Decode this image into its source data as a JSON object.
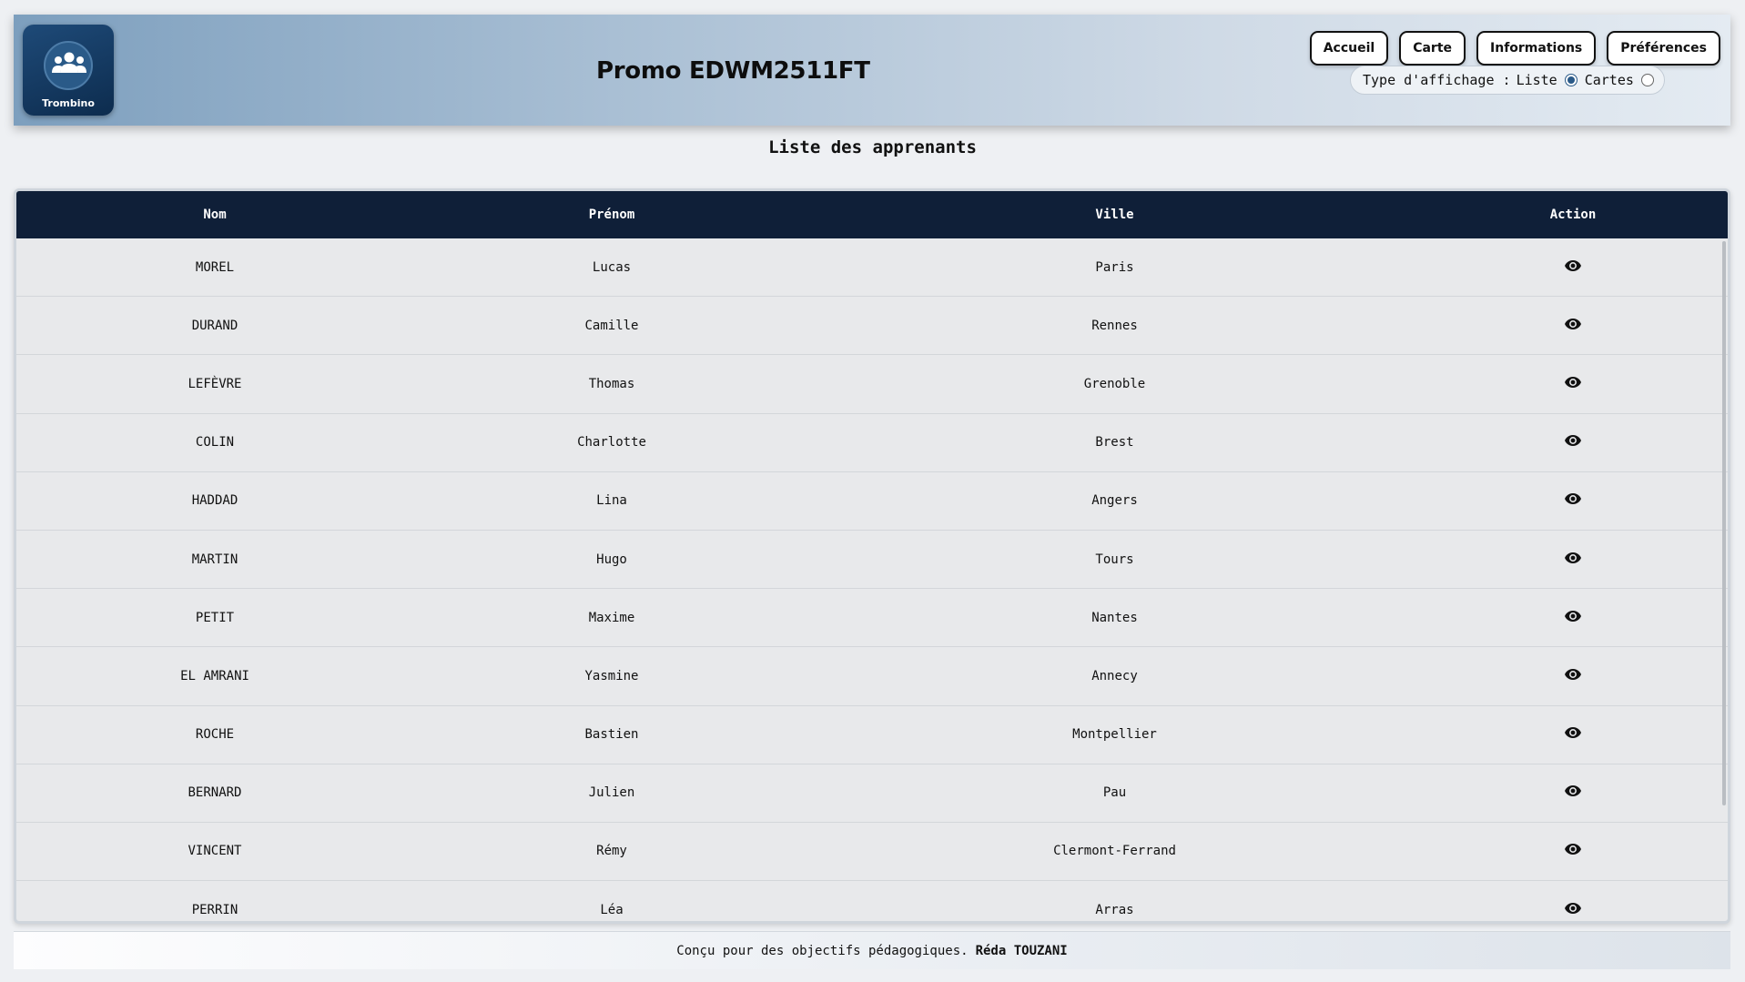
{
  "header": {
    "logo_text": "Trombino",
    "title": "Promo EDWM2511FT",
    "nav": [
      "Accueil",
      "Carte",
      "Informations",
      "Préférences"
    ],
    "display_toggle": {
      "label": "Type d'affichage :",
      "options": [
        "Liste",
        "Cartes"
      ],
      "selected": "Liste"
    }
  },
  "main": {
    "heading": "Liste des apprenants",
    "columns": [
      "Nom",
      "Prénom",
      "Ville",
      "Action"
    ],
    "rows": [
      [
        "MOREL",
        "Lucas",
        "Paris"
      ],
      [
        "DURAND",
        "Camille",
        "Rennes"
      ],
      [
        "LEFÈVRE",
        "Thomas",
        "Grenoble"
      ],
      [
        "COLIN",
        "Charlotte",
        "Brest"
      ],
      [
        "HADDAD",
        "Lina",
        "Angers"
      ],
      [
        "MARTIN",
        "Hugo",
        "Tours"
      ],
      [
        "PETIT",
        "Maxime",
        "Nantes"
      ],
      [
        "EL AMRANI",
        "Yasmine",
        "Annecy"
      ],
      [
        "ROCHE",
        "Bastien",
        "Montpellier"
      ],
      [
        "BERNARD",
        "Julien",
        "Pau"
      ],
      [
        "VINCENT",
        "Rémy",
        "Clermont-Ferrand"
      ],
      [
        "PERRIN",
        "Léa",
        "Arras"
      ]
    ],
    "action_icon": "eye-icon"
  },
  "footer": {
    "text": "Conçu pour des objectifs pédagogiques.",
    "author": "Réda TOUZANI"
  },
  "colors": {
    "table_header_bg": "#0f1f38",
    "logo_bg": "#0d2c4e",
    "page_bg": "#eef0f3"
  }
}
